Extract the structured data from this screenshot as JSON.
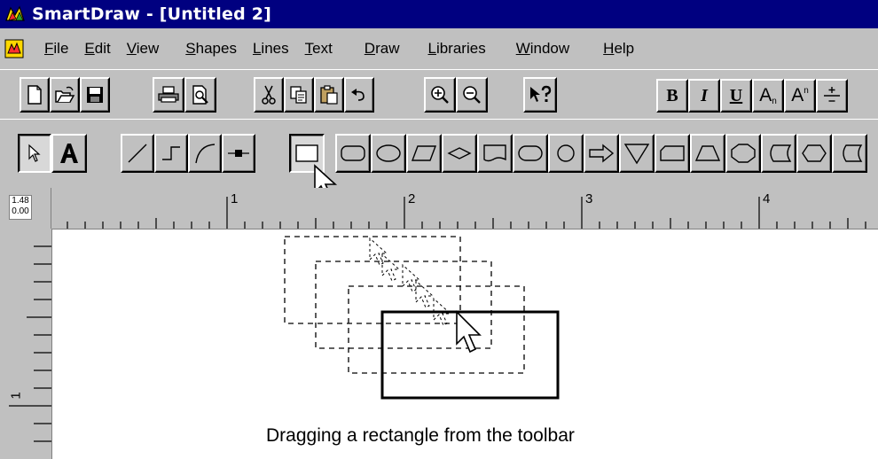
{
  "window": {
    "title": "SmartDraw - [Untitled 2]"
  },
  "menubar": {
    "items": [
      {
        "mnemonic": "F",
        "rest": "ile"
      },
      {
        "mnemonic": "E",
        "rest": "dit"
      },
      {
        "mnemonic": "V",
        "rest": "iew"
      },
      {
        "mnemonic": "S",
        "rest": "hapes"
      },
      {
        "mnemonic": "L",
        "rest": "ines"
      },
      {
        "mnemonic": "T",
        "rest": "ext"
      },
      {
        "mnemonic": "D",
        "rest": "raw"
      },
      {
        "mnemonic": "L",
        "rest": "ibraries"
      },
      {
        "mnemonic": "W",
        "rest": "indow"
      },
      {
        "mnemonic": "H",
        "rest": "elp"
      }
    ]
  },
  "toolbar": {
    "bold_label": "B",
    "italic_label": "I",
    "underline_label": "U",
    "subscript_label": "A",
    "superscript_label": "A"
  },
  "ruler": {
    "corner_top": "1.48",
    "corner_bottom": "0.00",
    "h_labels": [
      "1",
      "2",
      "3",
      "4"
    ],
    "v_labels": [
      "1"
    ]
  },
  "caption": "Dragging a rectangle from the toolbar"
}
